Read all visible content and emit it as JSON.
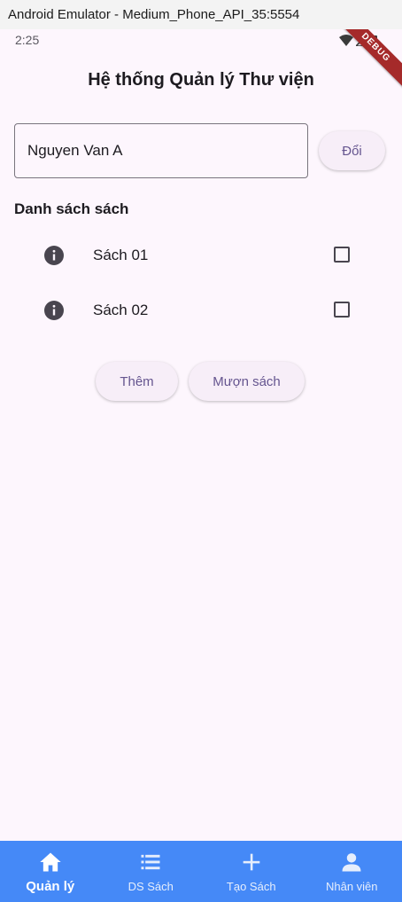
{
  "window": {
    "title": "Android Emulator - Medium_Phone_API_35:5554"
  },
  "status": {
    "time": "2:25",
    "debug_label": "DEBUG"
  },
  "app": {
    "title": "Hệ thống Quản lý Thư viện"
  },
  "form": {
    "name_value": "Nguyen Van A",
    "change_button": "Đổi"
  },
  "books": {
    "section_title": "Danh sách sách",
    "items": [
      {
        "label": "Sách 01",
        "checked": false
      },
      {
        "label": "Sách 02",
        "checked": false
      }
    ]
  },
  "actions": {
    "add_button": "Thêm",
    "borrow_button": "Mượn sách"
  },
  "nav": {
    "items": [
      {
        "label": "Quản lý",
        "icon": "home-icon",
        "active": true
      },
      {
        "label": "DS Sách",
        "icon": "list-icon",
        "active": false
      },
      {
        "label": "Tạo Sách",
        "icon": "add-icon",
        "active": false
      },
      {
        "label": "Nhân viên",
        "icon": "person-icon",
        "active": false
      }
    ]
  },
  "colors": {
    "nav_background": "#4589f7",
    "screen_background": "#fdf6fd",
    "button_text": "#65558f"
  }
}
